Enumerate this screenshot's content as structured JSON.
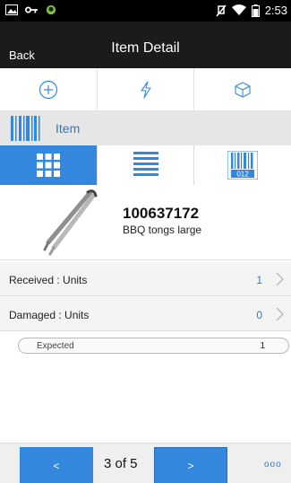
{
  "status_bar": {
    "time": "2:53",
    "icons": [
      "image-icon",
      "key-icon",
      "android-icon",
      "mute-icon",
      "wifi-icon",
      "battery-icon"
    ]
  },
  "header": {
    "back_label": "Back",
    "title": "Item Detail"
  },
  "actions": {
    "items": [
      "add-icon",
      "lightning-icon",
      "cube-icon"
    ]
  },
  "item_section": {
    "label": "Item"
  },
  "view_tabs": {
    "items": [
      "grid-view-icon",
      "list-view-icon",
      "barcode-view-icon"
    ],
    "barcode_caption": "012",
    "active_index": 0
  },
  "item": {
    "id": "100637172",
    "description": "BBQ tongs large",
    "image_icon": "tongs-image"
  },
  "rows": [
    {
      "label": "Received : Units",
      "value": "1"
    },
    {
      "label": "Damaged : Units",
      "value": "0"
    }
  ],
  "expected": {
    "label": "Expected",
    "value": "1"
  },
  "footer": {
    "prev_label": "<",
    "pager": "3 of 5",
    "next_label": ">",
    "more_label": "ooo"
  },
  "colors": {
    "accent": "#3388DD",
    "link": "#2E79C7",
    "title_bar": "#1B1B1B",
    "status_bar": "#000000",
    "section_bg": "#E6E6E6"
  }
}
